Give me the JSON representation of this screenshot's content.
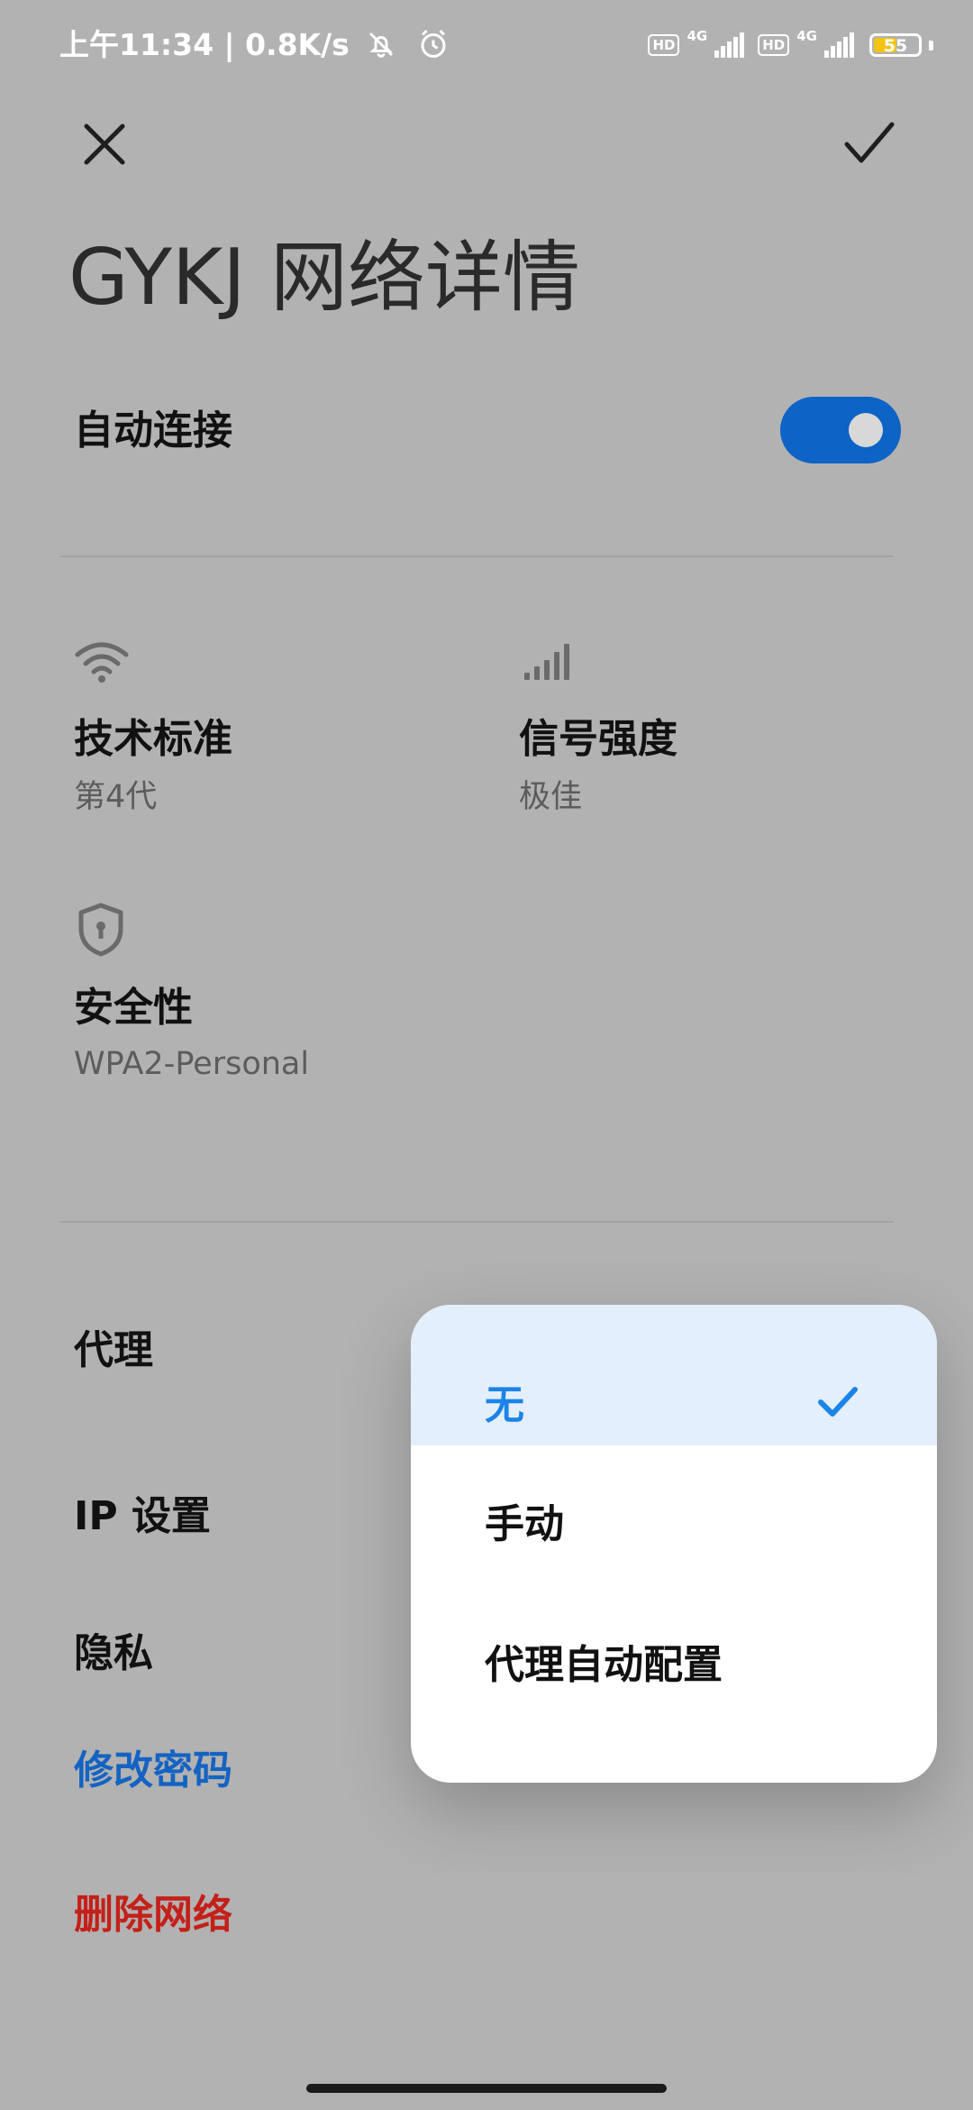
{
  "status_bar": {
    "time_speed": "上午11:34 | 0.8K/s",
    "hd1": "HD",
    "net1": "4G",
    "hd2": "HD",
    "net2": "4G",
    "battery": "55",
    "battery_level": 0.55,
    "icons": [
      "bell-off-icon",
      "alarm-icon",
      "signal-icon",
      "battery-icon"
    ]
  },
  "header": {
    "close_icon": "close-icon",
    "confirm_icon": "check-icon",
    "title": "GYKJ 网络详情"
  },
  "auto_connect": {
    "label": "自动连接",
    "enabled": true,
    "accent": "#0d63c6"
  },
  "details": [
    {
      "icon": "wifi-icon",
      "label": "技术标准",
      "value": "第4代"
    },
    {
      "icon": "signal-strength-icon",
      "label": "信号强度",
      "value": "极佳"
    },
    {
      "icon": "shield-lock-icon",
      "label": "安全性",
      "value": "WPA2-Personal"
    }
  ],
  "settings": {
    "proxy": "代理",
    "ip": "IP 设置",
    "privacy": "隐私",
    "change_password": "修改密码",
    "delete_network": "删除网络",
    "link_color": "#1463c2",
    "danger_color": "#c4201a"
  },
  "proxy_menu": {
    "options": [
      "无",
      "手动",
      "代理自动配置"
    ],
    "selected_index": 0,
    "selected_color": "#1b84e6"
  }
}
